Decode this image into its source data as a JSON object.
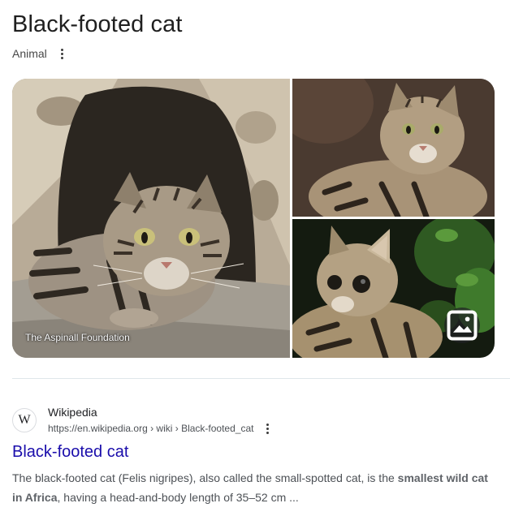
{
  "panel": {
    "title": "Black-footed cat",
    "subtitle": "Animal",
    "more_icon": "more-vert-icon"
  },
  "gallery": {
    "image_credit": "The Aspinall Foundation",
    "images_icon": "image-icon"
  },
  "result": {
    "site_name": "Wikipedia",
    "favicon_letter": "W",
    "url": "https://en.wikipedia.org › wiki › Black-footed_cat",
    "title": "Black-footed cat",
    "snippet_start": "The black-footed cat (Felis nigripes), also called the small-spotted cat, is the ",
    "snippet_bold1": "smallest",
    "snippet_space": " ",
    "snippet_bold2": "wild cat in Africa",
    "snippet_end": ", having a head-and-body length of 35–52 cm ..."
  }
}
